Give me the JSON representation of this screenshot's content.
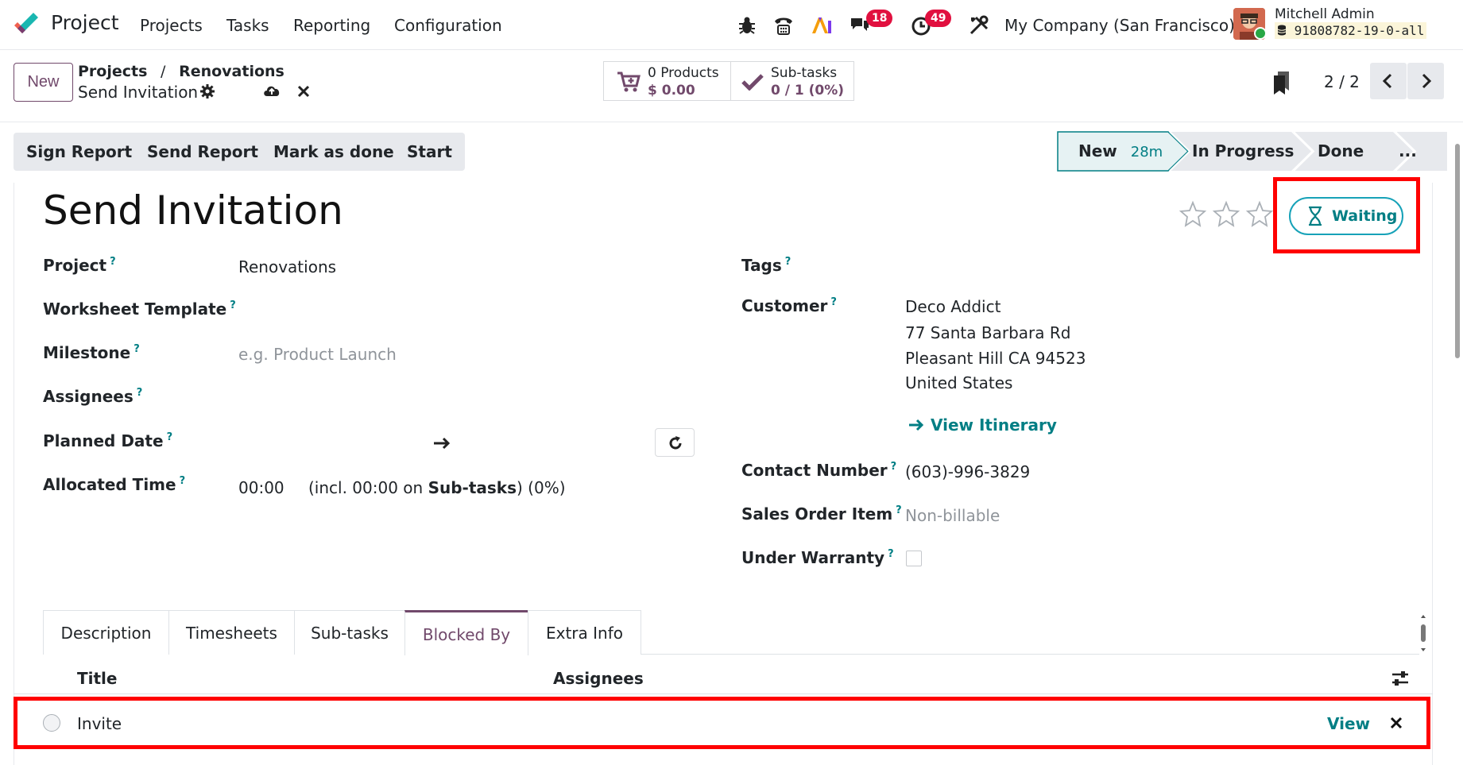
{
  "app": {
    "name": "Project"
  },
  "menu": [
    "Projects",
    "Tasks",
    "Reporting",
    "Configuration"
  ],
  "systray": {
    "messages_count": "18",
    "activities_count": "49",
    "company": "My Company (San Francisco)",
    "user": "Mitchell Admin",
    "db": "91808782-19-0-all"
  },
  "control": {
    "new_label": "New",
    "breadcrumb_parent": "Projects",
    "breadcrumb_sep": "/",
    "breadcrumb_project": "Renovations",
    "record_name": "Send Invitation",
    "products_line1": "0 Products",
    "products_line2": "$ 0.00",
    "subtasks_line1": "Sub-tasks",
    "subtasks_line2": "0 / 1 (0%)",
    "pager": "2 / 2"
  },
  "actions": [
    "Sign Report",
    "Send Report",
    "Mark as done",
    "Start"
  ],
  "stages": {
    "new": "New",
    "new_time": "28m",
    "in_progress": "In Progress",
    "done": "Done",
    "more": "..."
  },
  "form": {
    "title": "Send Invitation",
    "state_label": "Waiting",
    "fields_left": {
      "project_label": "Project",
      "project_value": "Renovations",
      "worksheet_label": "Worksheet Template",
      "milestone_label": "Milestone",
      "milestone_placeholder": "e.g. Product Launch",
      "assignees_label": "Assignees",
      "planned_label": "Planned Date",
      "allocated_label": "Allocated Time",
      "allocated_value": "00:00",
      "allocated_incl_prefix": "(incl. 00:00 on ",
      "allocated_incl_bold": "Sub-tasks",
      "allocated_incl_suffix": ") (0%)"
    },
    "fields_right": {
      "tags_label": "Tags",
      "customer_label": "Customer",
      "customer_name": "Deco Addict",
      "address_line1": "77 Santa Barbara Rd",
      "address_line2": "Pleasant Hill CA 94523",
      "address_line3": "United States",
      "itinerary": "View Itinerary",
      "contact_label": "Contact Number",
      "contact_value": "(603)-996-3829",
      "sale_label": "Sales Order Item",
      "sale_placeholder": "Non-billable",
      "warranty_label": "Under Warranty"
    },
    "help_mark": "?"
  },
  "tabs": [
    "Description",
    "Timesheets",
    "Sub-tasks",
    "Blocked By",
    "Extra Info"
  ],
  "blocked_table": {
    "col_title": "Title",
    "col_assignees": "Assignees",
    "rows": [
      {
        "title": "Invite",
        "view": "View"
      }
    ]
  },
  "colors": {
    "brand": "#71496b",
    "teal": "#017e84",
    "highlight": "#ff0000"
  }
}
